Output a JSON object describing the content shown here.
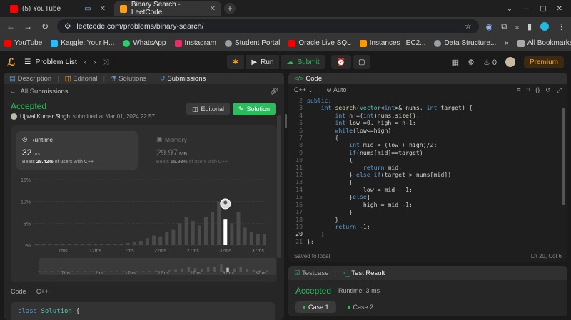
{
  "browser": {
    "tabs": [
      {
        "title": "(5) YouTube",
        "active": false,
        "color": "#ff0000"
      },
      {
        "title": "Binary Search - LeetCode",
        "active": true,
        "color": "#ffa116"
      }
    ],
    "url": "leetcode.com/problems/binary-search/",
    "bookmarks": [
      {
        "label": "YouTube",
        "color": "#ff0000"
      },
      {
        "label": "Kaggle: Your H...",
        "color": "#20beff"
      },
      {
        "label": "WhatsApp",
        "color": "#25d366"
      },
      {
        "label": "Instagram",
        "color": "#e1306c"
      },
      {
        "label": "Student Portal",
        "color": "#9aa0a6"
      },
      {
        "label": "Oracle Live SQL",
        "color": "#f80000"
      },
      {
        "label": "Instances | EC2...",
        "color": "#ff9900"
      },
      {
        "label": "Data Structure...",
        "color": "#9aa0a6"
      }
    ],
    "all_bookmarks": "All Bookmarks"
  },
  "lc": {
    "problem_list": "Problem List",
    "run": "Run",
    "submit": "Submit",
    "streak": "0",
    "premium": "Premium"
  },
  "left": {
    "tabs": [
      "Description",
      "Editorial",
      "Solutions",
      "Submissions"
    ],
    "all_submissions": "All Submissions",
    "status": "Accepted",
    "user": "Ujjwal Kumar Singh",
    "submitted": "submitted at Mar 01, 2024 22:57",
    "editorial_btn": "Editorial",
    "solution_btn": "Solution",
    "runtime": {
      "label": "Runtime",
      "value": "32",
      "unit": "ms",
      "beats_pre": "Beats",
      "beats": "28.42%",
      "beats_post": "of users with C++"
    },
    "memory": {
      "label": "Memory",
      "value": "29.97",
      "unit": "MB",
      "beats_pre": "Beats",
      "beats": "15.93%",
      "beats_post": "of users with C++"
    },
    "code_label": "Code",
    "code_lang": "C++",
    "code_first_line_kw": "class",
    "code_first_line_name": "Solution",
    "code_first_line_brace": "{"
  },
  "chart_data": {
    "type": "bar",
    "title": "",
    "ylabel": "",
    "xlabel": "",
    "yticks": [
      "15%",
      "10%",
      "5%",
      "0%"
    ],
    "ylim": [
      0,
      15
    ],
    "xticks": [
      "7ms",
      "12ms",
      "17ms",
      "22ms",
      "27ms",
      "32ms",
      "37ms"
    ],
    "x": [
      3,
      4,
      5,
      6,
      7,
      8,
      9,
      10,
      11,
      12,
      13,
      14,
      15,
      16,
      17,
      18,
      19,
      20,
      21,
      22,
      23,
      24,
      25,
      26,
      27,
      28,
      29,
      30,
      31,
      32,
      33,
      34,
      35,
      36,
      37,
      38
    ],
    "values": [
      0.3,
      0.3,
      0.3,
      0.3,
      0.3,
      0.3,
      0.3,
      0.3,
      0.3,
      0.3,
      0.3,
      0.3,
      0.3,
      0.3,
      0.5,
      0.7,
      1.0,
      1.6,
      2.2,
      2.0,
      3.0,
      3.5,
      5.0,
      6.5,
      5.5,
      4.5,
      6.5,
      7.5,
      10.0,
      6.0,
      5.0,
      7.5,
      4.0,
      3.0,
      2.5,
      2.5
    ],
    "highlight_x": 32,
    "highlight_value": 7.5,
    "colors": {
      "bar": "#4a4a4a",
      "highlight": "#ffffff"
    }
  },
  "editor": {
    "lang": "C++",
    "mode": "Auto",
    "footer_left": "Saved to local",
    "footer_right": "Ln 20, Col 6"
  },
  "result": {
    "tabs": [
      "Testcase",
      "Test Result"
    ],
    "status": "Accepted",
    "runtime": "Runtime: 3 ms",
    "cases": [
      "Case 1",
      "Case 2"
    ]
  }
}
